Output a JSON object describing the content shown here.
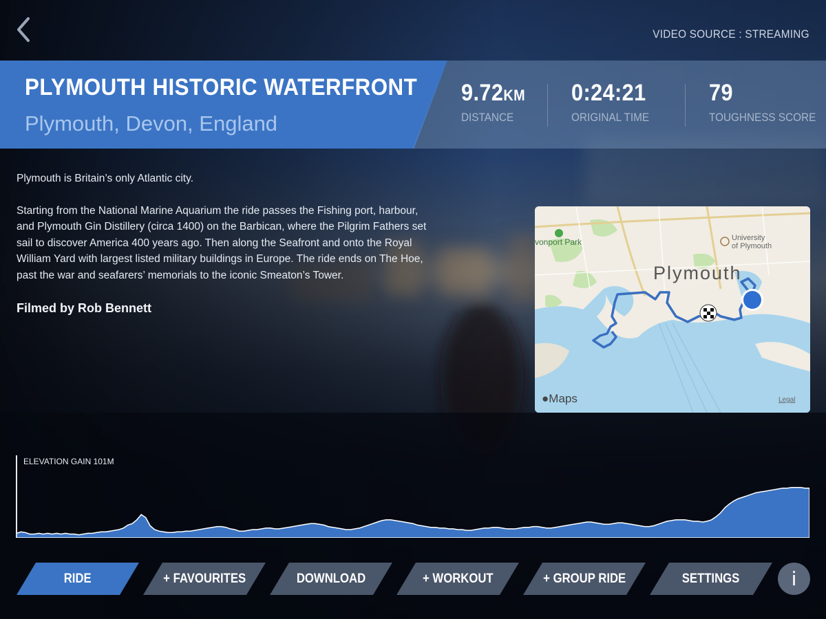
{
  "header": {
    "video_source": "VIDEO SOURCE : STREAMING"
  },
  "route": {
    "title": "PLYMOUTH HISTORIC WATERFRONT",
    "location": "Plymouth, Devon, England"
  },
  "stats": {
    "distance_value": "9.72",
    "distance_unit": "KM",
    "distance_label": "DISTANCE",
    "time_value": "0:24:21",
    "time_label": "ORIGINAL TIME",
    "toughness_value": "79",
    "toughness_label": "TOUGHNESS SCORE"
  },
  "description": {
    "intro": "Plymouth is Britain’s only Atlantic city.",
    "body": "Starting from the National Marine Aquarium the ride passes the Fishing port, harbour, and Plymouth Gin Distillery (circa 1400) on the Barbican, where the Pilgrim Fathers set sail to discover America 400 years ago. Then along the Seafront and onto the Royal William Yard with largest listed military buildings in Europe. The ride ends on The Hoe, past the war and seafarers’ memorials to the iconic Smeaton’s Tower.",
    "filmed_by": "Filmed by Rob Bennett"
  },
  "map": {
    "city_label": "Plymouth",
    "park_label": "vonport Park",
    "university_line1": "University",
    "university_line2": "of Plymouth",
    "brand": "Maps",
    "legal": "Legal",
    "water_color": "#a9d4ec",
    "land_color": "#f1ede4",
    "park_color": "#c7e3b0",
    "route_color": "#3a6fc0"
  },
  "elevation": {
    "label": "ELEVATION GAIN 101M",
    "fill_color": "#3b74c4",
    "profile": [
      6,
      8,
      7,
      5,
      5,
      6,
      5,
      6,
      5,
      6,
      5,
      6,
      5,
      5,
      4,
      5,
      6,
      6,
      7,
      8,
      8,
      9,
      10,
      11,
      13,
      17,
      19,
      24,
      31,
      27,
      16,
      11,
      9,
      8,
      7,
      7,
      8,
      8,
      9,
      9,
      10,
      11,
      12,
      13,
      14,
      15,
      15,
      14,
      12,
      11,
      9,
      9,
      10,
      11,
      11,
      12,
      13,
      13,
      12,
      12,
      13,
      14,
      15,
      16,
      17,
      18,
      19,
      19,
      18,
      17,
      15,
      14,
      13,
      12,
      11,
      11,
      12,
      13,
      15,
      17,
      19,
      21,
      23,
      24,
      24,
      23,
      22,
      21,
      20,
      19,
      17,
      16,
      15,
      14,
      14,
      13,
      13,
      12,
      12,
      11,
      11,
      10,
      10,
      11,
      12,
      13,
      13,
      14,
      14,
      13,
      12,
      12,
      12,
      13,
      14,
      14,
      15,
      15,
      14,
      13,
      13,
      14,
      15,
      16,
      17,
      18,
      19,
      20,
      21,
      21,
      20,
      19,
      18,
      18,
      19,
      20,
      20,
      19,
      18,
      17,
      16,
      15,
      15,
      16,
      18,
      20,
      22,
      23,
      24,
      24,
      24,
      23,
      22,
      22,
      21,
      22,
      24,
      28,
      33,
      40,
      45,
      49,
      52,
      54,
      56,
      58,
      60,
      61,
      62,
      63,
      64,
      65,
      66,
      66,
      67,
      67,
      67,
      66,
      66
    ]
  },
  "nav": {
    "ride": "RIDE",
    "favourites": "+ FAVOURITES",
    "download": "DOWNLOAD",
    "workout": "+ WORKOUT",
    "group_ride": "+ GROUP RIDE",
    "settings": "SETTINGS",
    "info": "i"
  }
}
